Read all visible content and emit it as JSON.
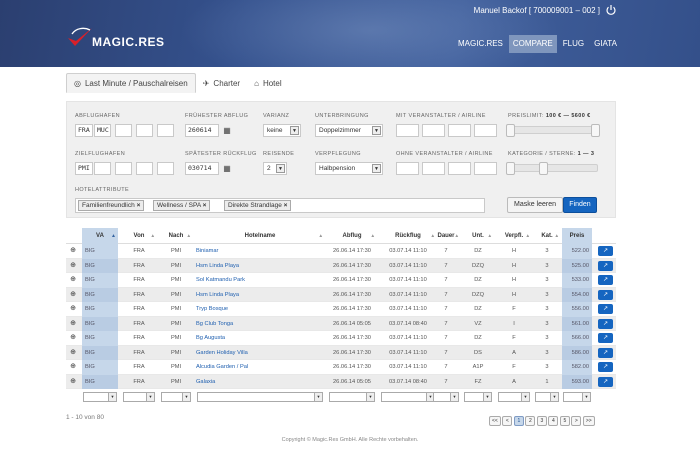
{
  "header": {
    "brand": "MAGIC.RES",
    "user": "Manuel Backof [ 700009001 – 002 ]",
    "nav": [
      "MAGIC.RES",
      "COMPARE",
      "FLUG",
      "GIATA"
    ],
    "nav_active": "COMPARE",
    "colors": {
      "bar": "#35528e",
      "nav_active": "#7f96bd"
    }
  },
  "tabs": [
    {
      "label": "Last Minute / Pauschalreisen",
      "icon": "globe-icon",
      "active": true
    },
    {
      "label": "Charter",
      "icon": "plane-icon",
      "active": false
    },
    {
      "label": "Hotel",
      "icon": "home-icon",
      "active": false
    }
  ],
  "form": {
    "abflughafen": {
      "label": "ABFLUGHAFEN",
      "values": [
        "FRA",
        "MUC",
        "",
        "",
        "",
        ""
      ]
    },
    "zielflughafen": {
      "label": "ZIELFLUGHAFEN",
      "values": [
        "PMI",
        "",
        "",
        "",
        "",
        ""
      ]
    },
    "fruehester": {
      "label": "FRÜHESTER ABFLUG",
      "value": "260614"
    },
    "spaetester": {
      "label": "SPÄTESTER RÜCKFLUG",
      "value": "030714"
    },
    "varianz": {
      "label": "VARIANZ",
      "value": "keine"
    },
    "reisende": {
      "label": "REISENDE",
      "value": "2"
    },
    "unterbringung": {
      "label": "UNTERBRINGUNG",
      "value": "Doppelzimmer"
    },
    "verpflegung": {
      "label": "VERPFLEGUNG",
      "value": "Halbpension"
    },
    "mit_va": {
      "label": "MIT VERANSTALTER / AIRLINE"
    },
    "ohne_va": {
      "label": "OHNE VERANSTALTER / AIRLINE"
    },
    "preislimit": {
      "label": "PREISLIMIT:",
      "range": "100 € — 5600 €",
      "low": 100,
      "high": 5600
    },
    "kategorie": {
      "label": "KATEGORIE / STERNE:",
      "range": "1 — 3",
      "low": 1,
      "high": 3
    },
    "hotelattribute": {
      "label": "HOTELATTRIBUTE",
      "tags": [
        "Familienfreundlich",
        "Wellness / SPA",
        "Direkte Strandlage"
      ]
    },
    "btn_clear": "Maske leeren",
    "btn_find": "Finden"
  },
  "table": {
    "columns": [
      "VA",
      "Von",
      "Nach",
      "Hotelname",
      "Abflug",
      "Rückflug",
      "Dauer",
      "Unt.",
      "Verpfl.",
      "Kat.",
      "Preis"
    ],
    "rows": [
      [
        "BIG",
        "FRA",
        "PMI",
        "Biniamar",
        "26.06.14 17:30",
        "03.07.14 11:10",
        "7",
        "DZ",
        "H",
        "3",
        "522.00"
      ],
      [
        "BIG",
        "FRA",
        "PMI",
        "Hsm Linda Playa",
        "26.06.14 17:30",
        "03.07.14 11:10",
        "7",
        "DZQ",
        "H",
        "3",
        "525.00"
      ],
      [
        "BIG",
        "FRA",
        "PMI",
        "Sol Katmandu Park",
        "26.06.14 17:30",
        "03.07.14 11:10",
        "7",
        "DZ",
        "H",
        "3",
        "533.00"
      ],
      [
        "BIG",
        "FRA",
        "PMI",
        "Hsm Linda Playa",
        "26.06.14 17:30",
        "03.07.14 11:10",
        "7",
        "DZQ",
        "H",
        "3",
        "554.00"
      ],
      [
        "BIG",
        "FRA",
        "PMI",
        "Tryp Bosque",
        "26.06.14 17:30",
        "03.07.14 11:10",
        "7",
        "DZ",
        "F",
        "3",
        "556.00"
      ],
      [
        "BIG",
        "FRA",
        "PMI",
        "Bg Club Tonga",
        "26.06.14 05:05",
        "03.07.14 08:40",
        "7",
        "VZ",
        "I",
        "3",
        "561.00"
      ],
      [
        "BIG",
        "FRA",
        "PMI",
        "Bg Augusta",
        "26.06.14 17:30",
        "03.07.14 11:10",
        "7",
        "DZ",
        "F",
        "3",
        "566.00"
      ],
      [
        "BIG",
        "FRA",
        "PMI",
        "Garden Holiday Villa",
        "26.06.14 17:30",
        "03.07.14 11:10",
        "7",
        "DS",
        "A",
        "3",
        "586.00"
      ],
      [
        "BIG",
        "FRA",
        "PMI",
        "Alcudia Garden / Pal",
        "26.06.14 17:30",
        "03.07.14 11:10",
        "7",
        "A1P",
        "F",
        "3",
        "582.00"
      ],
      [
        "BIG",
        "FRA",
        "PMI",
        "Galaxia",
        "26.06.14 05:05",
        "03.07.14 08:40",
        "7",
        "FZ",
        "A",
        "1",
        "593.00"
      ]
    ]
  },
  "pagination": {
    "summary": "1 - 10 von 80",
    "pages": [
      "<<",
      "<",
      "1",
      "2",
      "3",
      "4",
      "5",
      ">",
      ">>"
    ],
    "current": "1"
  },
  "footer": "Copyright © Magic.Res GmbH. Alle Rechte vorbehalten."
}
